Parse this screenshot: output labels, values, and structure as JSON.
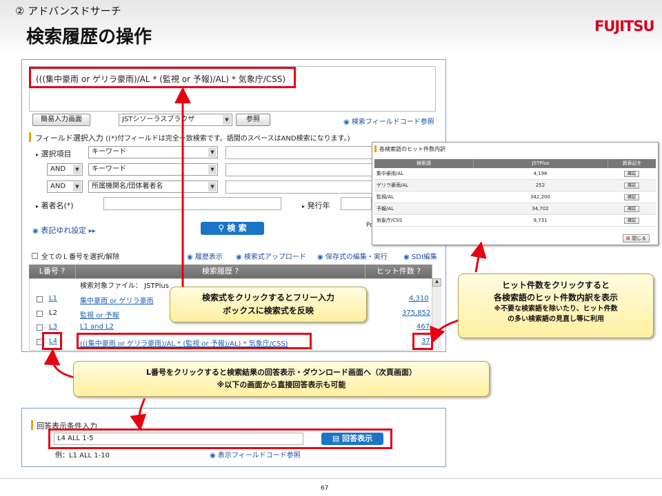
{
  "slide": {
    "subtitle": "② アドバンスドサーチ",
    "title": "検索履歴の操作",
    "logo": "FUJITSU",
    "page_number": "67"
  },
  "query": {
    "text": "(((集中豪雨 or ゲリラ豪雨)/AL * (監視 or 予報)/AL) * 気象庁/CSS)"
  },
  "toolbar": {
    "simple_button": "簡易入力画面",
    "thesaurus_select": "JSTシソーラスブラウザ",
    "ref_button": "参照",
    "field_code_link": "検索フィールドコード参照"
  },
  "field": {
    "heading": "フィールド選択入力",
    "note": "((*)付フィールドは完全一致検索です。語間のスペースはAND検索になります。)",
    "select_item_label": "選択項目",
    "rows": [
      {
        "op": "",
        "field": "キーワード"
      },
      {
        "op": "AND",
        "field": "キーワード"
      },
      {
        "op": "AND",
        "field": "所属機関名/団体著者名"
      }
    ],
    "author_label": "著者名(*)",
    "year_label": "発行年",
    "notation_label": "表記ゆれ設定",
    "search_button": "検 索",
    "trunc": "Po"
  },
  "history": {
    "select_all": "全てのＬ番号を選択/解除",
    "links": [
      "履歴表示",
      "検索式アップロード",
      "保存式の編集・実行",
      "SDI編集"
    ],
    "columns": [
      "L番号",
      "検索履歴",
      "ヒット件数"
    ],
    "file_label": "検索対象ファイル： JSTPlus",
    "rows": [
      {
        "l": "L1",
        "query": "集中豪雨 or ゲリラ豪雨",
        "hits": "4,310"
      },
      {
        "l": "L2",
        "query": "監視 or 予報",
        "hits": "375,852"
      },
      {
        "l": "L3",
        "query": "L1 and L2",
        "hits": "467"
      },
      {
        "l": "L4",
        "query": "(((集中豪雨 or ゲリラ豪雨)/AL * (監視 or 予報)/AL) * 気象庁/CSS)",
        "hits": "37"
      }
    ]
  },
  "popup": {
    "title": "各検索語のヒット件数内訳",
    "columns": [
      "検索語",
      "JSTPlus",
      "異表記を"
    ],
    "rows": [
      {
        "term": "集中豪雨/AL",
        "count": "4,198",
        "btn": "確認"
      },
      {
        "term": "ゲリラ豪雨/AL",
        "count": "252",
        "btn": "確認"
      },
      {
        "term": "監視/AL",
        "count": "342,200",
        "btn": "確認"
      },
      {
        "term": "予報/AL",
        "count": "34,702",
        "btn": "確認"
      },
      {
        "term": "気象庁/CSS",
        "count": "9,731",
        "btn": "確認"
      }
    ],
    "close": "閉じる"
  },
  "answer": {
    "heading": "回答表示条件入力",
    "value": "L4 ALL 1-5",
    "button": "回答表示",
    "example": "例：L1 ALL 1-10",
    "field_link": "表示フィールドコード参照"
  },
  "callouts": {
    "query": [
      "検索式をクリックするとフリー入力",
      "ボックスに検索式を反映"
    ],
    "hits": [
      "ヒット件数をクリックすると",
      "各検索語のヒット件数内訳を表示",
      "※不要な検索語を除いたり、ヒット件数",
      "の多い検索語の見直し等に利用"
    ],
    "lnum": [
      "L番号をクリックすると検索結果の回答表示・ダウンロード画面へ（次頁画面）",
      "※以下の画面から直接回答表示も可能"
    ]
  },
  "colors": {
    "accent_red": "#e60012",
    "brand": "#d40020"
  }
}
